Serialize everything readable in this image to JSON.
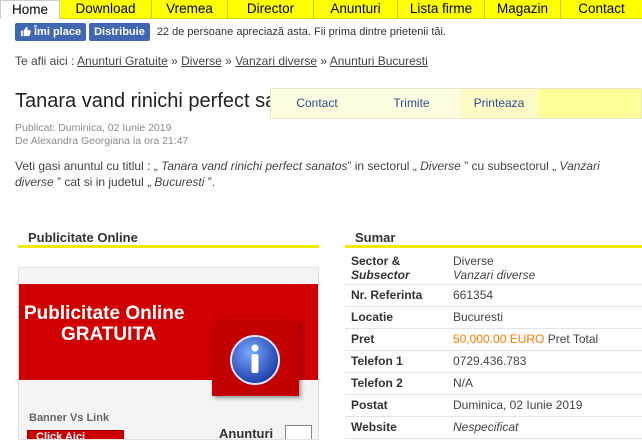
{
  "nav": {
    "items": [
      {
        "label": "Home",
        "active": true
      },
      {
        "label": "Download"
      },
      {
        "label": "Vremea"
      },
      {
        "label": "Director"
      },
      {
        "label": "Anunturi"
      },
      {
        "label": "Lista firme"
      },
      {
        "label": "Magazin"
      },
      {
        "label": "Contact"
      }
    ]
  },
  "social": {
    "like_label": "Îmi place",
    "share_label": "Distribuie",
    "count_text": "22 de persoane apreciază asta. Fii prima dintre prietenii tăi."
  },
  "breadcrumb": {
    "prefix": "Te afli aici :",
    "items": [
      "Anunturi Gratuite",
      "Diverse",
      "Vanzari diverse",
      "Anunturi Bucuresti"
    ],
    "separator": "»"
  },
  "page": {
    "title": "Tanara vand rinichi perfect sanatos",
    "published": "Publicat: Duminica, 02 Iunie 2019",
    "author": "De Alexandra Georgiana la ora 21:47",
    "intro": {
      "p1": "Veti gasi anuntul cu titlul : „",
      "title": " Tanara vand rinichi perfect sanatos",
      "p2": "” in sectorul „",
      "sector": " Diverse ",
      "p3": "” cu subsectorul „",
      "subsector": " Vanzari diverse ",
      "p4": "” cat si in judetul „",
      "judet": " Bucuresti ",
      "p5": "”."
    }
  },
  "actions": {
    "contact": "Contact",
    "trimite": "Trimite",
    "printeaza": "Printeaza"
  },
  "left": {
    "heading": "Publicitate Online",
    "ad": {
      "line1": "Publicitate Online",
      "line2": "GRATUITA",
      "banner_label": "Banner Vs Link",
      "click_label": "Click Aici",
      "anunturi_label": "Anunturi"
    }
  },
  "sumar": {
    "heading": "Sumar",
    "sector_label": "Sector &",
    "subsector_label": "Subsector",
    "sector_value": "Diverse",
    "subsector_value": "Vanzari diverse",
    "rows": [
      {
        "key": "Nr. Referinta",
        "value": "661354"
      },
      {
        "key": "Locatie",
        "value": "Bucuresti"
      },
      {
        "key": "Pret",
        "value": "50,000.00 EURO",
        "suffix": " Pret Total"
      },
      {
        "key": "Telefon 1",
        "value": "0729.436.783"
      },
      {
        "key": "Telefon 2",
        "value": "N/A"
      },
      {
        "key": "Postat",
        "value": "Duminica, 02 Iunie 2019"
      },
      {
        "key": "Website",
        "value": "Nespecificat"
      }
    ]
  },
  "colors": {
    "nav_bg": "#ffff00",
    "fb_blue": "#4267b2",
    "ad_red": "#d00000",
    "price_orange": "#ff7a00",
    "link_blue": "#2a4f8f"
  }
}
